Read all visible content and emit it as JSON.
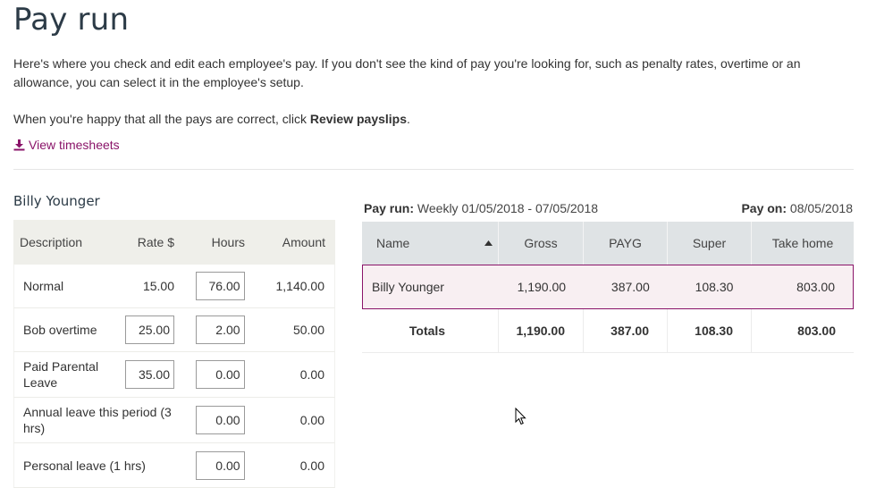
{
  "page": {
    "title": "Pay run",
    "intro_p1": "Here's where you check and edit each employee's pay. If you don't see the kind of pay you're looking for, such as penalty rates, overtime or an allowance, you can select it in the employee's setup.",
    "intro_p2_prefix": "When you're happy that all the pays are correct, click ",
    "intro_p2_bold": "Review payslips",
    "intro_p2_suffix": ".",
    "view_timesheets": "View timesheets"
  },
  "employee": {
    "name": "Billy Younger",
    "columns": {
      "description": "Description",
      "rate": "Rate $",
      "hours": "Hours",
      "amount": "Amount"
    },
    "lines": [
      {
        "description": "Normal",
        "rate": "15.00",
        "rate_editable": false,
        "hours": "76.00",
        "amount": "1,140.00"
      },
      {
        "description": "Bob overtime",
        "rate": "25.00",
        "rate_editable": true,
        "hours": "2.00",
        "amount": "50.00"
      },
      {
        "description": "Paid Parental Leave",
        "rate": "35.00",
        "rate_editable": true,
        "hours": "0.00",
        "amount": "0.00"
      },
      {
        "description": "Annual leave this period (3 hrs)",
        "rate": "",
        "rate_editable": false,
        "hours": "0.00",
        "amount": "0.00"
      },
      {
        "description": "Personal leave (1 hrs)",
        "rate": "",
        "rate_editable": false,
        "hours": "0.00",
        "amount": "0.00"
      }
    ]
  },
  "summary": {
    "pay_run_label": "Pay run:",
    "pay_run_value": "Weekly 01/05/2018 - 07/05/2018",
    "pay_on_label": "Pay on:",
    "pay_on_value": "08/05/2018",
    "columns": {
      "name": "Name",
      "gross": "Gross",
      "payg": "PAYG",
      "super": "Super",
      "take_home": "Take home"
    },
    "rows": [
      {
        "name": "Billy Younger",
        "gross": "1,190.00",
        "payg": "387.00",
        "super": "108.30",
        "take_home": "803.00"
      }
    ],
    "totals": {
      "label": "Totals",
      "gross": "1,190.00",
      "payg": "387.00",
      "super": "108.30",
      "take_home": "803.00"
    }
  },
  "colors": {
    "accent": "#8a1469",
    "selected_row_bg": "#f8eff2",
    "header_bg": "#dfe3e5"
  },
  "icons": {
    "view_timesheets": "download-icon",
    "sort": "sort-up-icon",
    "cursor": "mouse-pointer-icon"
  }
}
